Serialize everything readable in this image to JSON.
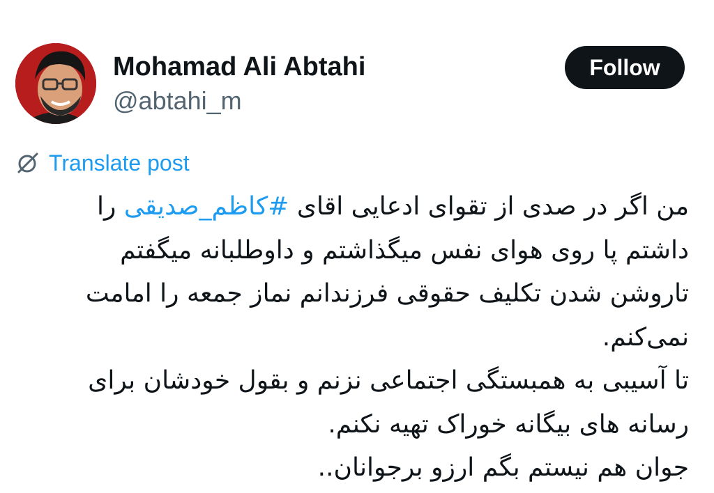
{
  "author": {
    "name": "Mohamad Ali Abtahi",
    "handle": "@abtahi_m",
    "avatar_icon": "profile-photo"
  },
  "follow_button": {
    "label": "Follow"
  },
  "translate": {
    "icon": "globe-slash-icon",
    "label": "Translate post"
  },
  "post": {
    "line1_start": "من اگر در صدی از تقوای ادعایی اقای ",
    "hashtag": "#کاظم_صدیقی",
    "line1_end": " را",
    "line2": "داشتم پا روی هوای نفس میگذاشتم و داوطلبانه میگفتم",
    "line3": "تاروشن شدن تکلیف حقوقی فرزندانم نماز جمعه را امامت",
    "line4": "نمی‌کنم.",
    "line5": "تا آسیبی به همبستگی اجتماعی نزنم و بقول خودشان برای",
    "line6": "رسانه های بیگانه خوراک تهیه نکنم.",
    "line7": "جوان هم نیستم بگم ارزو برجوانان.."
  },
  "colors": {
    "text": "#0f1419",
    "secondary": "#536471",
    "link": "#1d9bf0",
    "button_bg": "#0f1419",
    "button_text": "#ffffff"
  }
}
